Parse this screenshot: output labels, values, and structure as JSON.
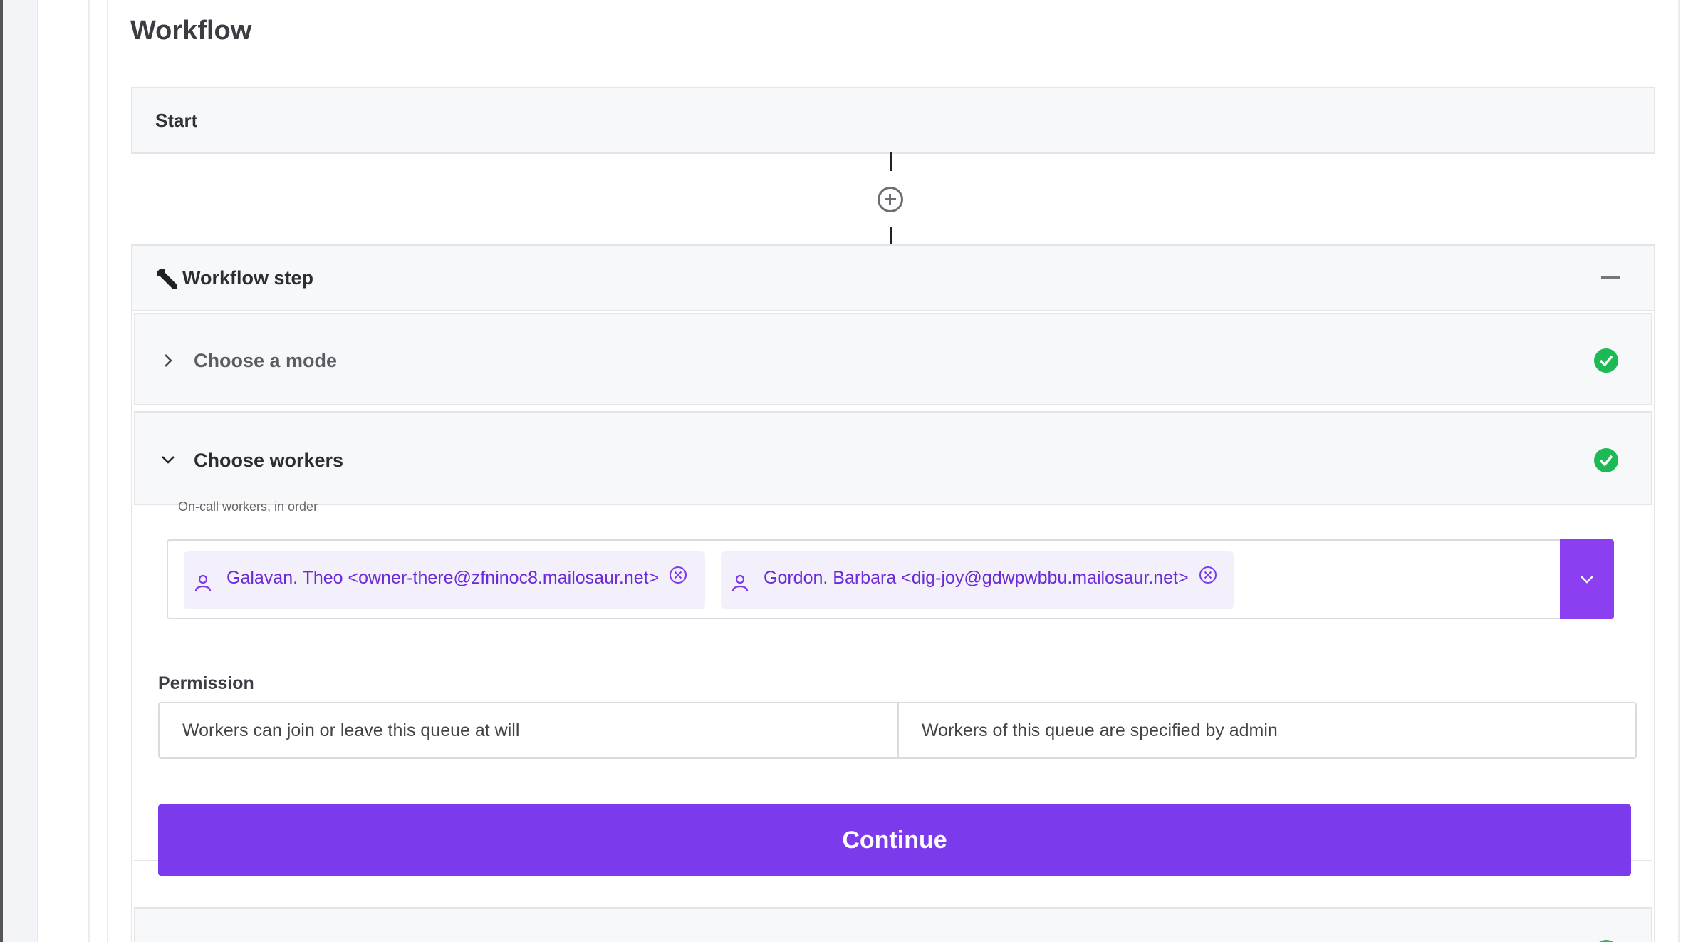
{
  "page": {
    "title": "Workflow"
  },
  "start": {
    "label": "Start"
  },
  "step": {
    "title": "Workflow step",
    "sections": {
      "mode": {
        "label": "Choose a mode",
        "complete": true
      },
      "workers": {
        "label": "Choose workers",
        "complete": true
      }
    }
  },
  "workers_field": {
    "label": "On-call workers, in order",
    "selected": [
      "Galavan. Theo <owner-there@zfninoc8.mailosaur.net>",
      "Gordon. Barbara <dig-joy@gdwpwbbu.mailosaur.net>"
    ]
  },
  "permission": {
    "label": "Permission",
    "options": [
      "Workers can join or leave this queue at will",
      "Workers of this queue are specified by admin"
    ]
  },
  "actions": {
    "continue_label": "Continue"
  },
  "colors": {
    "accent": "#7c3aed",
    "success": "#1db954",
    "chip_text": "#6c2bd9"
  }
}
